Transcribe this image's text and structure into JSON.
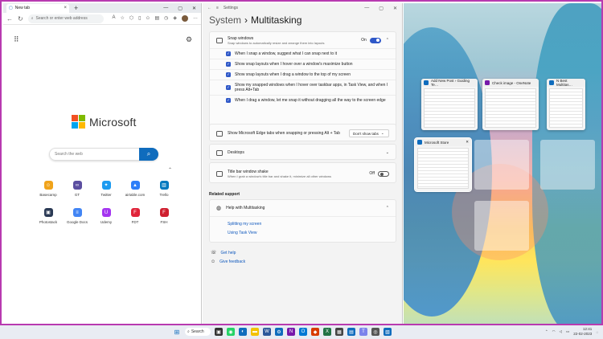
{
  "edge": {
    "tab_title": "New tab",
    "address_placeholder": "Search or enter web address",
    "logo_text": "Microsoft",
    "search_placeholder": "Search the web",
    "tiles": [
      {
        "label": "Basecamp",
        "color": "#f0a31a",
        "glyph": "☺"
      },
      {
        "label": "GT",
        "color": "#5b4ea0",
        "glyph": "∞"
      },
      {
        "label": "Twitter",
        "color": "#1d9bf0",
        "glyph": "✦"
      },
      {
        "label": "airtable.com",
        "color": "#2d7ff9",
        "glyph": "▲"
      },
      {
        "label": "Trello",
        "color": "#0079bf",
        "glyph": "▥"
      },
      {
        "label": "Photostack",
        "color": "#2b3a55",
        "glyph": "▣"
      },
      {
        "label": "Google Docs",
        "color": "#4285f4",
        "glyph": "≡"
      },
      {
        "label": "Udemy",
        "color": "#a435f0",
        "glyph": "U"
      },
      {
        "label": "FDT",
        "color": "#e0243a",
        "glyph": "F"
      },
      {
        "label": "FSH",
        "color": "#cf1f2f",
        "glyph": "F"
      }
    ]
  },
  "settings": {
    "window_title": "Settings",
    "breadcrumb_parent": "System",
    "breadcrumb_sep": "›",
    "page_title": "Multitasking",
    "snap": {
      "title": "Snap windows",
      "desc": "Snap windows to automatically resize and arrange them into layouts",
      "state": "On",
      "options": [
        "When I snap a window, suggest what I can snap next to it",
        "Show snap layouts when I hover over a window's maximize button",
        "Show snap layouts when I drag a window to the top of my screen",
        "Show my snapped windows when I hover over taskbar apps, in Task View, and when I press Alt+Tab",
        "When I drag a window, let me snap it without dragging all the way to the screen edge"
      ]
    },
    "edge_tabs": {
      "label": "Show Microsoft Edge tabs when snapping or pressing Alt + Tab",
      "value": "Don't show tabs"
    },
    "desktops": {
      "label": "Desktops"
    },
    "shake": {
      "title": "Title bar window shake",
      "desc": "When I grab a window's title bar and shake it, minimize all other windows",
      "state": "Off"
    },
    "related_header": "Related support",
    "help": {
      "title": "Help with Multitasking",
      "links": [
        "Splitting my screen",
        "Using Task View"
      ]
    },
    "get_help": "Get help",
    "give_feedback": "Give feedback"
  },
  "snap_assist": {
    "thumbs": [
      {
        "title": "Add New Post ‹ Guiding Te…",
        "color": "#0f6cbd"
      },
      {
        "title": "Check image - OneNote",
        "color": "#7719aa"
      },
      {
        "title": "N Best Multitas…",
        "color": "#0f6cbd"
      },
      {
        "title": "Microsoft Store",
        "color": "#0f6cbd"
      }
    ]
  },
  "taskbar": {
    "search_label": "Search",
    "time": "12:41",
    "date": "22-02-2023"
  }
}
